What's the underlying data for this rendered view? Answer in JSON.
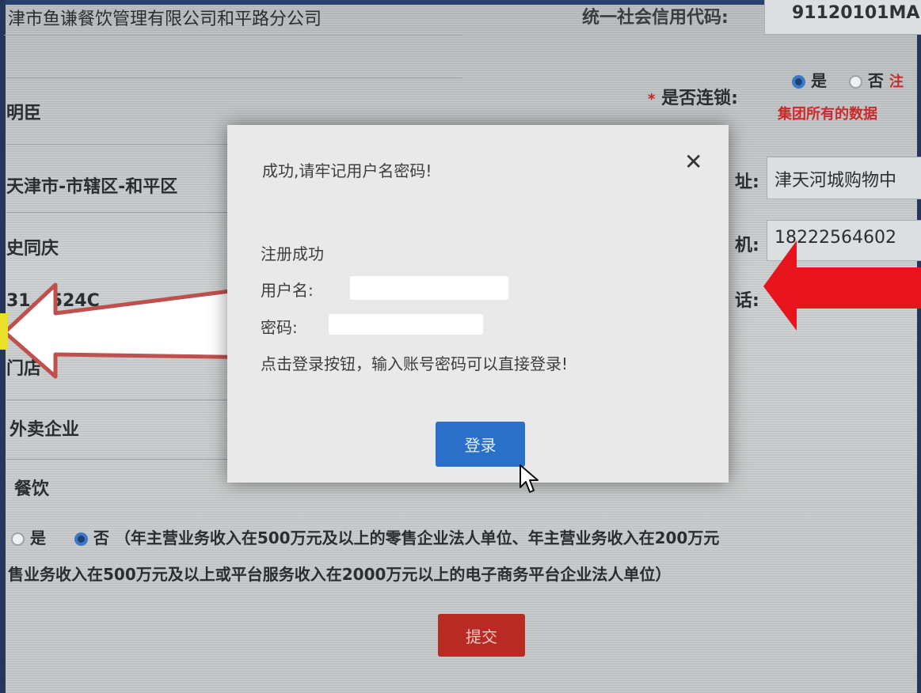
{
  "form": {
    "company_name": "津市鱼谦餐饮管理有限公司和平路分公司",
    "credit_code_label": "统一社会信用代码:",
    "credit_code_value": "91120101MA",
    "legal_rep_partial": "明臣",
    "chain_label": "是否连锁:",
    "chain_yes": "是",
    "chain_no": "否",
    "chain_note_partial": "注",
    "chain_hint": "集团所有的数据",
    "region": "天津市-市辖区-和平区",
    "address_label_partial": "址:",
    "address_value": "津天河城购物中",
    "contact_name": "史同庆",
    "phone_label_partial": "机:",
    "phone_value": "18222564602",
    "tel_label_partial": "话:",
    "row_partial_number": "31...524C",
    "store_type": "门店",
    "takeout": "外卖企业",
    "industry": "餐饮",
    "scale_yes": "是",
    "scale_no": "否",
    "scale_note_line1": "（年主营业务收入在500万元及以上的零售企业法人单位、年主营业务收入在200万元",
    "scale_note_line2": "售业务收入在500万元及以上或平台服务收入在2000万元以上的电子商务平台企业法人单位）",
    "required_mark": "*",
    "submit_label": "提交"
  },
  "modal": {
    "title": "成功,请牢记用户名密码!",
    "close_symbol": "✕",
    "line1": "注册成功",
    "username_label": "用户名:",
    "password_label": "密码:",
    "line4": "点击登录按钮，输入账号密码可以直接登录!",
    "login_label": "登录"
  },
  "colors": {
    "login_button": "#2a6fc8",
    "submit_button": "#b82a24",
    "red_arrow": "#e8141c",
    "white_arrow_outline": "#c0504d"
  }
}
